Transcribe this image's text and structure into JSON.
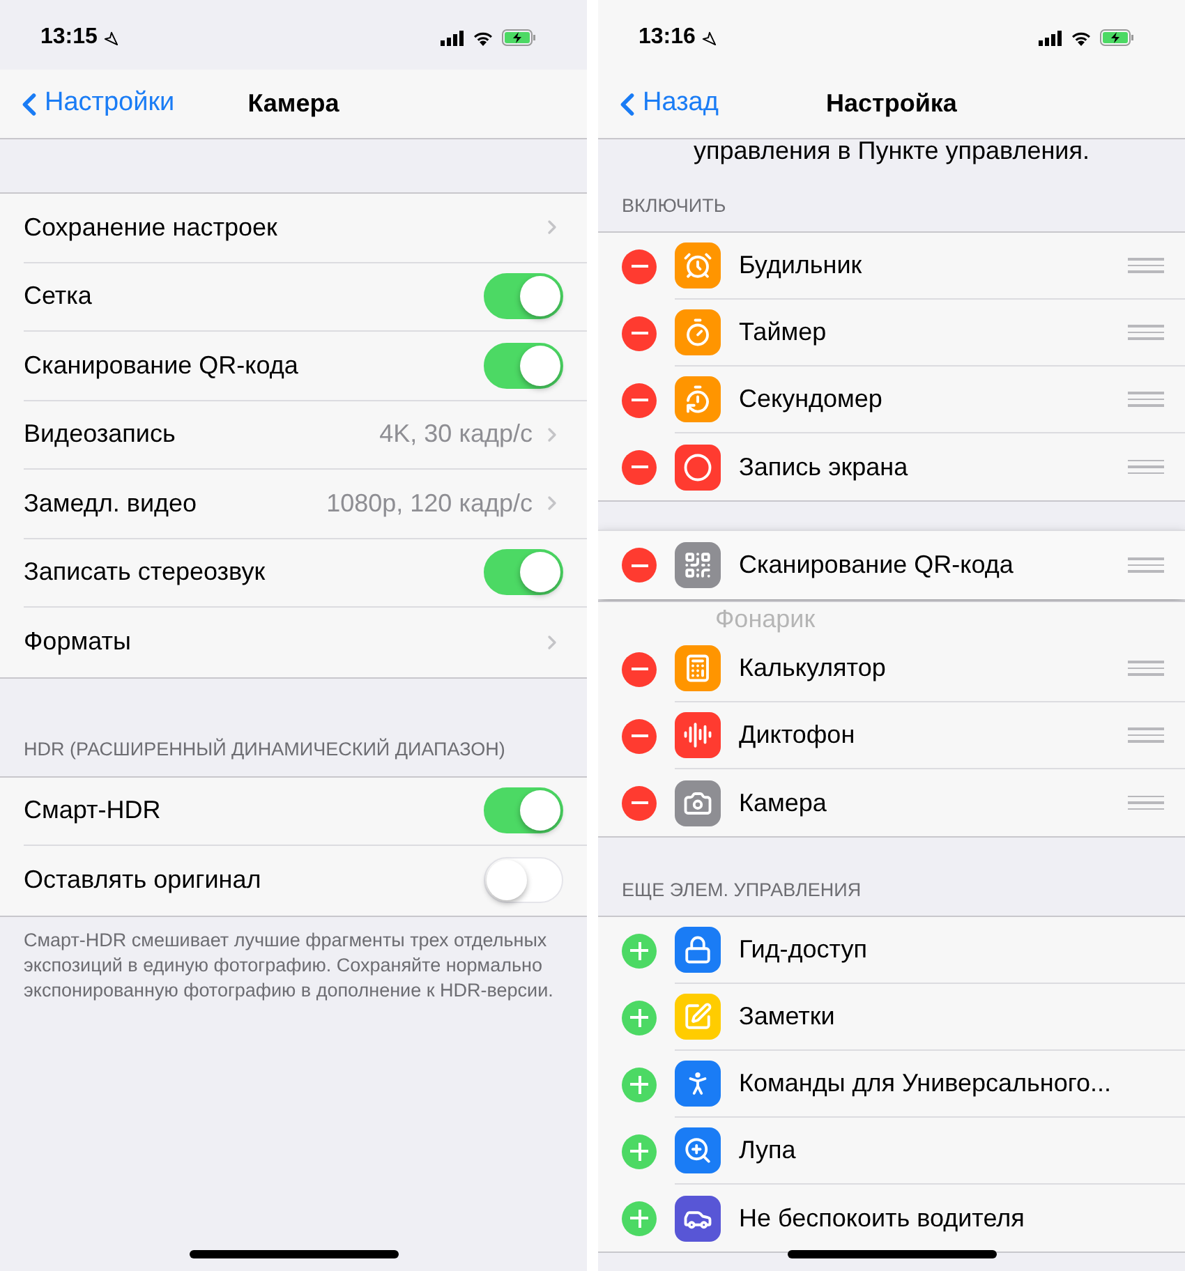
{
  "left": {
    "status_bar": {
      "time": "13:15"
    },
    "nav": {
      "back": "Настройки",
      "title": "Камера"
    },
    "groups": [
      {
        "rows": [
          {
            "kind": "link",
            "label": "Сохранение настроек"
          },
          {
            "kind": "toggle",
            "label": "Сетка",
            "on": true
          },
          {
            "kind": "toggle",
            "label": "Сканирование QR-кода",
            "on": true
          },
          {
            "kind": "link",
            "label": "Видеозапись",
            "value": "4K, 30 кадр/с"
          },
          {
            "kind": "link",
            "label": "Замедл. видео",
            "value": "1080p, 120 кадр/с"
          },
          {
            "kind": "toggle",
            "label": "Записать стереозвук",
            "on": true
          },
          {
            "kind": "link",
            "label": "Форматы"
          }
        ]
      },
      {
        "header": "HDR (РАСШИРЕННЫЙ ДИНАМИЧЕСКИЙ ДИАПАЗОН)",
        "rows": [
          {
            "kind": "toggle",
            "label": "Смарт-HDR",
            "on": true
          },
          {
            "kind": "toggle",
            "label": "Оставлять оригинал",
            "on": false
          }
        ]
      }
    ],
    "footer": "Смарт-HDR смешивает лучшие фрагменты трех отдельных экспозиций в единую фотографию. Сохраняйте нормально экспонированную фотографию в дополнение к HDR-версии."
  },
  "right": {
    "status_bar": {
      "time": "13:16"
    },
    "nav": {
      "back": "Назад",
      "title": "Настройка"
    },
    "intro": "управления в Пункте управления.",
    "sections": [
      {
        "header": "ВКЛЮЧИТЬ",
        "items": [
          {
            "label": "Будильник",
            "dragging": false,
            "faded": false
          },
          {
            "label": "Таймер",
            "dragging": false,
            "faded": false
          },
          {
            "label": "Секундомер",
            "dragging": false,
            "faded": false
          },
          {
            "label": "Запись экрана",
            "dragging": false,
            "faded": false
          },
          {
            "label": "Сканирование QR-кода",
            "dragging": true,
            "faded": false
          },
          {
            "label": "Фонарик",
            "dragging": false,
            "faded": true
          },
          {
            "label": "Калькулятор",
            "dragging": false,
            "faded": false
          },
          {
            "label": "Диктофон",
            "dragging": false,
            "faded": false
          },
          {
            "label": "Камера",
            "dragging": false,
            "faded": false
          }
        ]
      },
      {
        "header": "ЕЩЕ ЭЛЕМ. УПРАВЛЕНИЯ",
        "items": [
          {
            "label": "Гид-доступ",
            "dragging": false,
            "faded": false
          },
          {
            "label": "Заметки",
            "dragging": false,
            "faded": false
          },
          {
            "label": "Команды для Универсального...",
            "dragging": false,
            "faded": false
          },
          {
            "label": "Лупа",
            "dragging": false,
            "faded": false
          },
          {
            "label": "Не беспокоить водителя",
            "dragging": false,
            "faded": false
          }
        ]
      }
    ]
  }
}
